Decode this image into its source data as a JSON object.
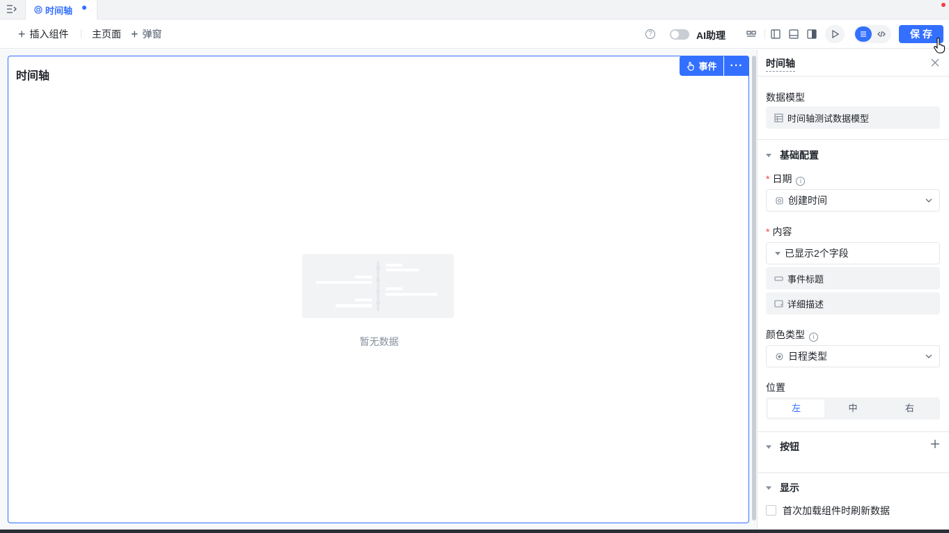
{
  "tabs": [
    {
      "label": "时间轴",
      "modified": true
    }
  ],
  "toolbar": {
    "insert_label": "插入组件",
    "main_page_label": "主页面",
    "popup_label": "弹窗",
    "help_glyph": "?",
    "ai_label": "AI助理",
    "ai_enabled": false,
    "save_label": "保存"
  },
  "canvas": {
    "component_title": "时间轴",
    "event_label": "事件",
    "more_glyph": "···",
    "empty_text": "暂无数据"
  },
  "panel": {
    "title": "时间轴",
    "data_model_label": "数据模型",
    "data_model_value": "时间轴测试数据模型",
    "basic_section": "基础配置",
    "required_mark": "*",
    "date_label": "日期",
    "date_value": "创建时间",
    "content_label": "内容",
    "content_summary": "已显示2个字段",
    "content_fields": [
      "事件标题",
      "详细描述"
    ],
    "color_type_label": "颜色类型",
    "color_type_value": "日程类型",
    "position_label": "位置",
    "position_options": [
      "左",
      "中",
      "右"
    ],
    "position_selected": "左",
    "buttons_section": "按钮",
    "display_section": "显示",
    "refresh_label": "首次加载组件时刷新数据",
    "info_glyph": "i"
  },
  "colors": {
    "accent": "#3370ff",
    "danger": "#f53f3f"
  }
}
